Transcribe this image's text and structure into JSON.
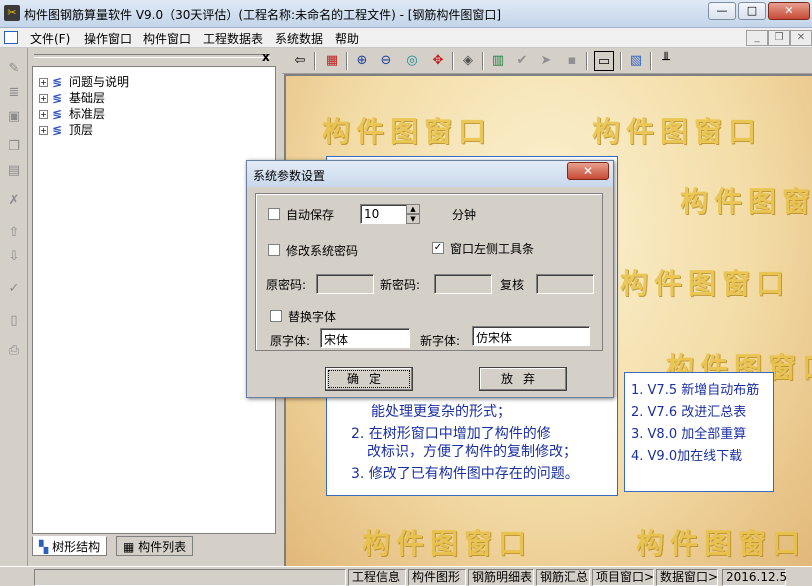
{
  "window": {
    "title": "构件图钢筋算量软件 V9.0（30天评估）(工程名称:未命名的工程文件) - [钢筋构件图窗口]",
    "minimize": "—",
    "maximize": "□",
    "close": "✕"
  },
  "menu": {
    "items": [
      "文件(F)",
      "操作窗口",
      "构件窗口",
      "工程数据表",
      "系统数据",
      "帮助"
    ],
    "mdi_controls": [
      "_",
      "❐",
      "✕"
    ]
  },
  "tree": {
    "close": "x",
    "nodes": [
      "问题与说明",
      "基础层",
      "标准层",
      "顶层"
    ],
    "expander": "+",
    "tabs": [
      "树形结构",
      "构件列表"
    ]
  },
  "toolbar": {
    "icons": [
      "arrow-left-icon",
      "grid-icon",
      "zoom-in-icon",
      "zoom-out-icon",
      "layers-icon",
      "target-icon",
      "eraser-icon",
      "columns-icon",
      "check-icon",
      "forward-icon",
      "stop-icon",
      "window-icon",
      "palette-icon",
      "ruler-icon"
    ],
    "glyphs": [
      "⇦",
      "▦",
      "⊕",
      "⊖",
      "◎",
      "✥",
      "◈",
      "▥",
      "✔",
      "➤",
      "▪",
      "▭",
      "▧",
      "╨"
    ]
  },
  "canvas": {
    "watermark": "构件图窗口",
    "info_lines": [
      "能处理更复杂的形式；",
      "2. 在树形窗口中增加了构件的修",
      "改标识，方便了构件的复制修改；",
      "3. 修改了已有构件图中存在的问题。"
    ],
    "versions": [
      "1. V7.5 新增自动布筋",
      "2. V7.6 改进汇总表",
      "3. V8.0 加全部重算",
      "4.  V9.0加在线下载"
    ]
  },
  "dialog": {
    "title": "系统参数设置",
    "close": "✕",
    "autosave": {
      "label": "自动保存",
      "checked": false,
      "value": "10",
      "unit": "分钟"
    },
    "change_password": {
      "label": "修改系统密码",
      "checked": false
    },
    "left_toolbar": {
      "label": "窗口左侧工具条",
      "checked": true,
      "mark": "✓"
    },
    "old_password_label": "原密码:",
    "new_password_label": "新密码:",
    "confirm_label": "复核",
    "replace_font": {
      "label": "替换字体",
      "checked": false
    },
    "old_font_label": "原字体:",
    "old_font_value": "宋体",
    "new_font_label": "新字体:",
    "new_font_value": "仿宋体",
    "ok": "确定",
    "cancel": "放弃"
  },
  "status": {
    "items": [
      "工程信息",
      "构件图形",
      "钢筋明细表",
      "钢筋汇总",
      "项目窗口>",
      "数据窗口>"
    ],
    "date": "2016.12.5"
  }
}
